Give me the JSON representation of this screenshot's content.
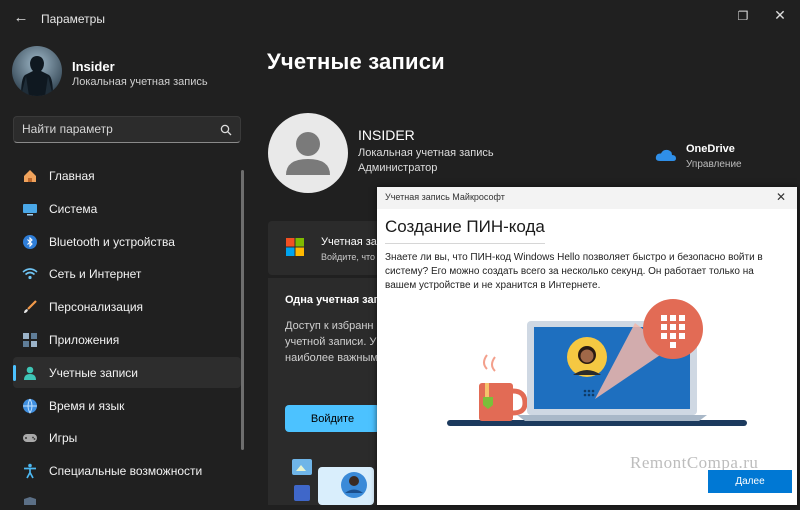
{
  "window": {
    "title": "Параметры"
  },
  "profile": {
    "name": "Insider",
    "type": "Локальная учетная запись"
  },
  "search": {
    "placeholder": "Найти параметр"
  },
  "nav": {
    "items": [
      {
        "label": "Главная",
        "icon": "home-icon"
      },
      {
        "label": "Система",
        "icon": "system-icon"
      },
      {
        "label": "Bluetooth и устройства",
        "icon": "bluetooth-icon"
      },
      {
        "label": "Сеть и Интернет",
        "icon": "wifi-icon"
      },
      {
        "label": "Персонализация",
        "icon": "brush-icon"
      },
      {
        "label": "Приложения",
        "icon": "apps-icon"
      },
      {
        "label": "Учетные записи",
        "icon": "person-icon",
        "active": true
      },
      {
        "label": "Время и язык",
        "icon": "globe-icon"
      },
      {
        "label": "Игры",
        "icon": "gamepad-icon"
      },
      {
        "label": "Специальные возможности",
        "icon": "accessibility-icon"
      }
    ]
  },
  "main": {
    "title": "Учетные записи",
    "account": {
      "name": "INSIDER",
      "type": "Локальная учетная запись",
      "role": "Администратор"
    },
    "onedrive": {
      "title": "OneDrive",
      "subtitle": "Управление"
    },
    "ms_card": {
      "title": "Учетная за",
      "subtitle": "Войдите, что"
    },
    "one_account": {
      "heading": "Одна учетная запи",
      "lines": [
        "Доступ к избранн",
        "учетной записи. У",
        "наиболее важным"
      ],
      "button": "Войдите"
    }
  },
  "dialog": {
    "bar_title": "Учетная запись Майкрософт",
    "title": "Создание ПИН-кода",
    "body": "Знаете ли вы, что ПИН-код Windows Hello позволяет быстро и безопасно войти в систему? Его можно создать всего за несколько секунд. Он работает только на вашем устройстве и не хранится в Интернете.",
    "next": "Далее"
  },
  "watermark": "RemontCompa.ru",
  "colors": {
    "accent": "#4cc2ff",
    "dialog_button": "#0078d4",
    "illustration_blue": "#1e6fbf",
    "illustration_red": "#e26b55"
  }
}
